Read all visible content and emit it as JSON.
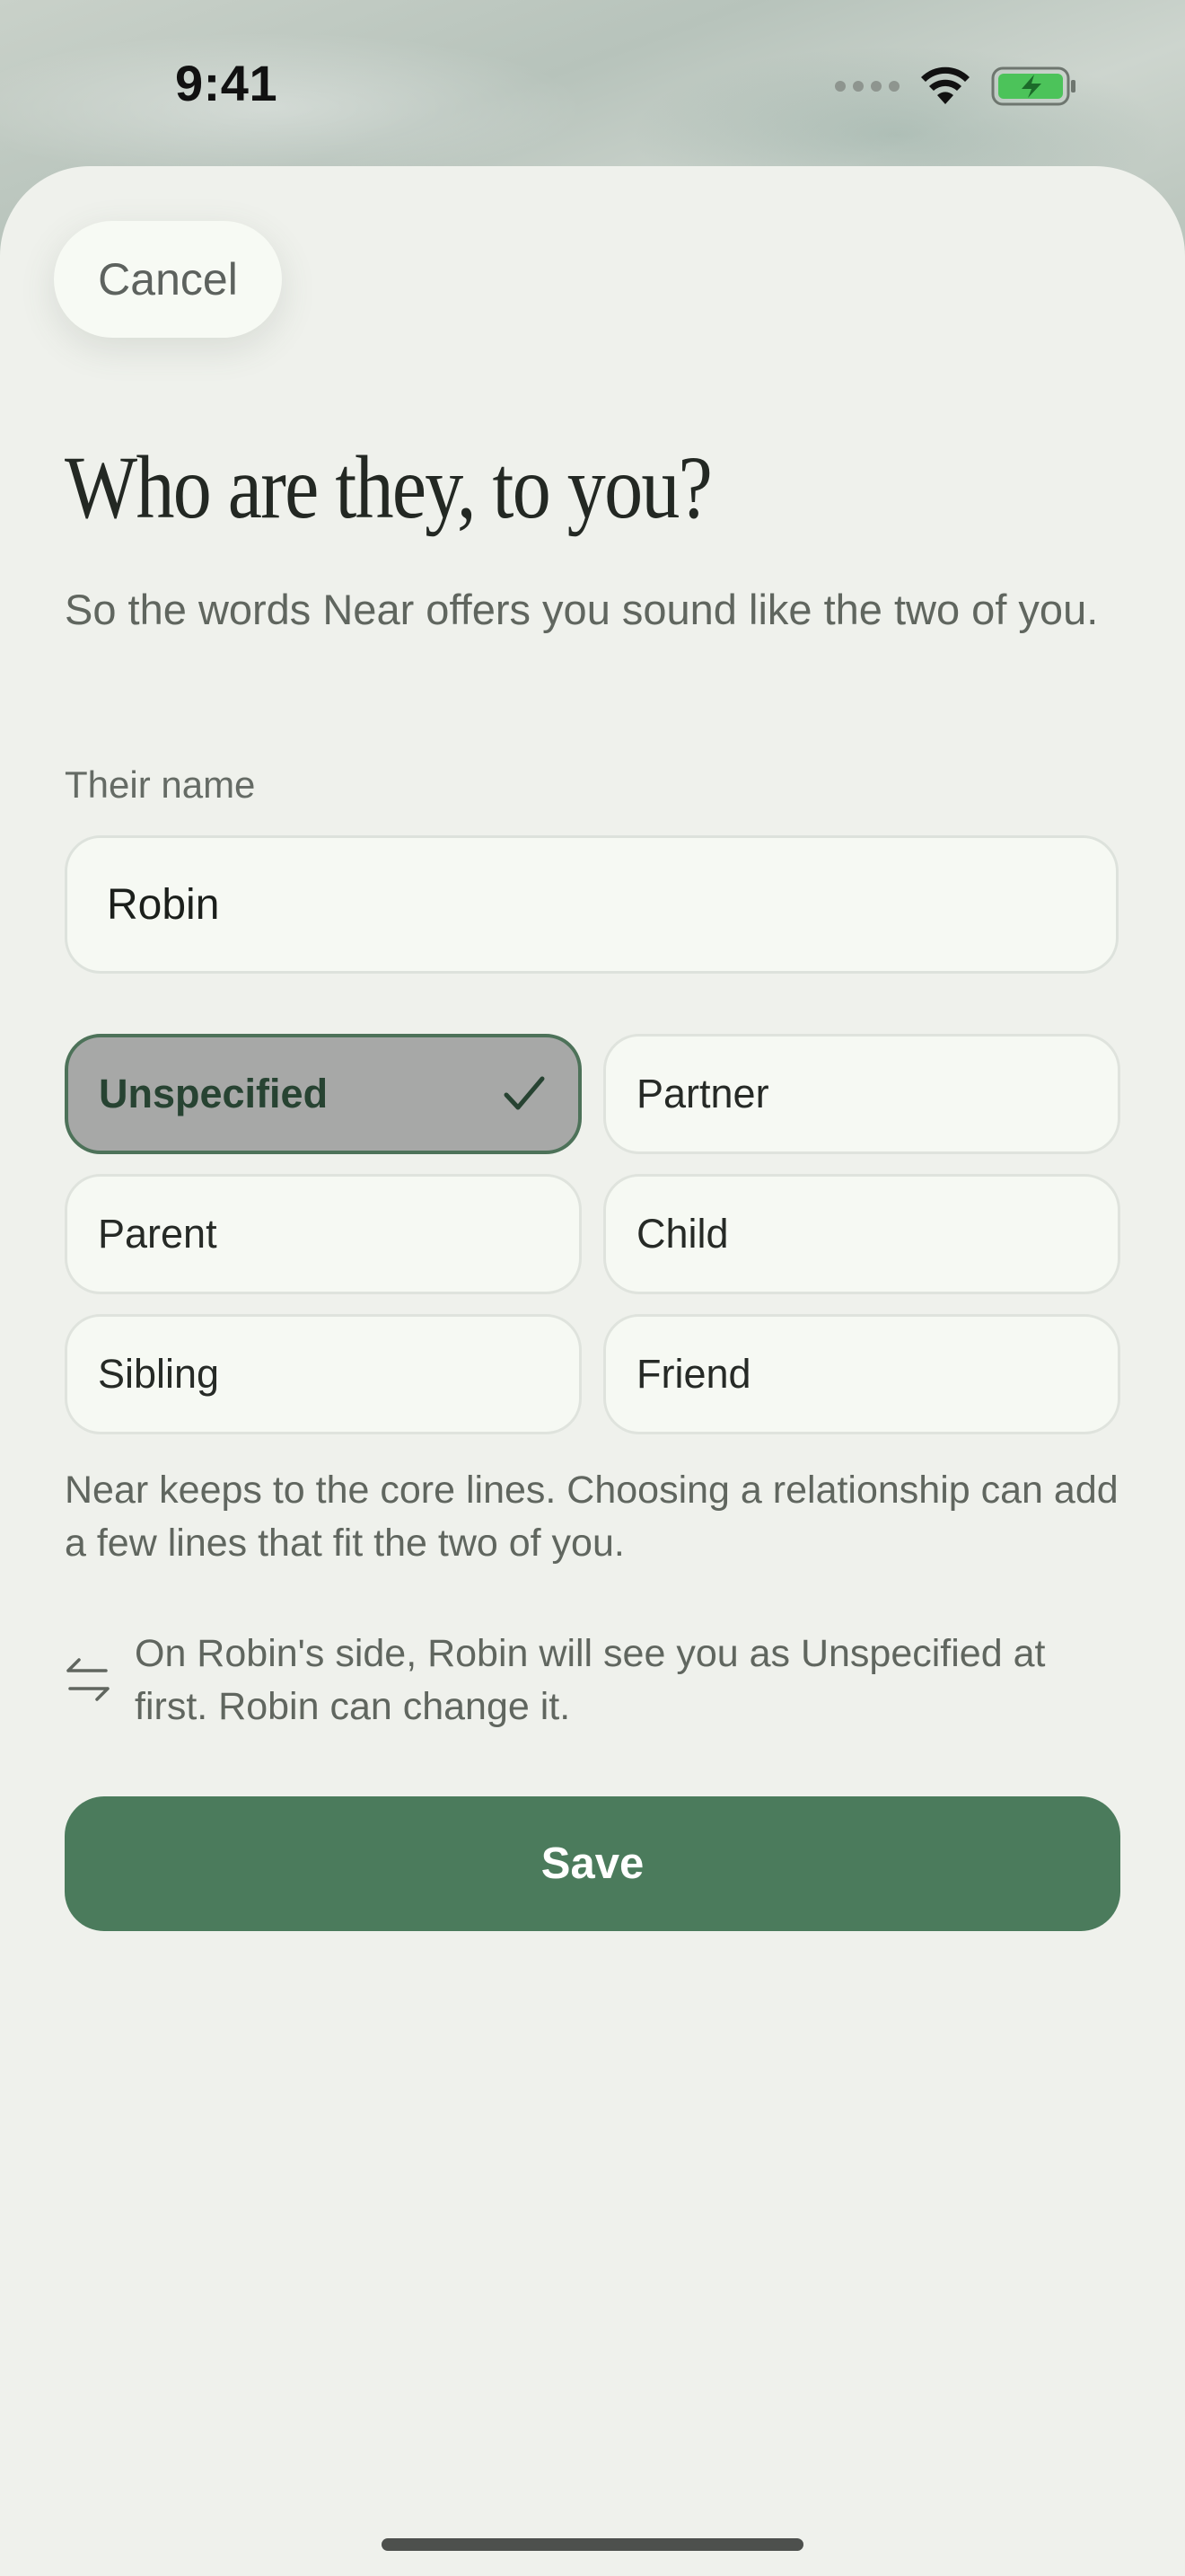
{
  "status_bar": {
    "time": "9:41"
  },
  "sheet": {
    "cancel_label": "Cancel",
    "title": "Who are they, to you?",
    "subtitle": "So the words Near offers you sound like the two of you.",
    "name_field": {
      "label": "Their name",
      "value": "Robin"
    },
    "relationships": [
      {
        "label": "Unspecified",
        "selected": true
      },
      {
        "label": "Partner",
        "selected": false
      },
      {
        "label": "Parent",
        "selected": false
      },
      {
        "label": "Child",
        "selected": false
      },
      {
        "label": "Sibling",
        "selected": false
      },
      {
        "label": "Friend",
        "selected": false
      }
    ],
    "help_text": "Near keeps to the core lines. Choosing a relationship can add a few lines that fit the two of you.",
    "sync_note": "On Robin's side, Robin will see you as Unspecified at first. Robin can change it.",
    "save_label": "Save"
  },
  "colors": {
    "accent": "#4b7b5c",
    "sheet_background": "#eff1ec",
    "selected_chip": "#a7a8a7",
    "battery_charging": "#4cc35a"
  }
}
